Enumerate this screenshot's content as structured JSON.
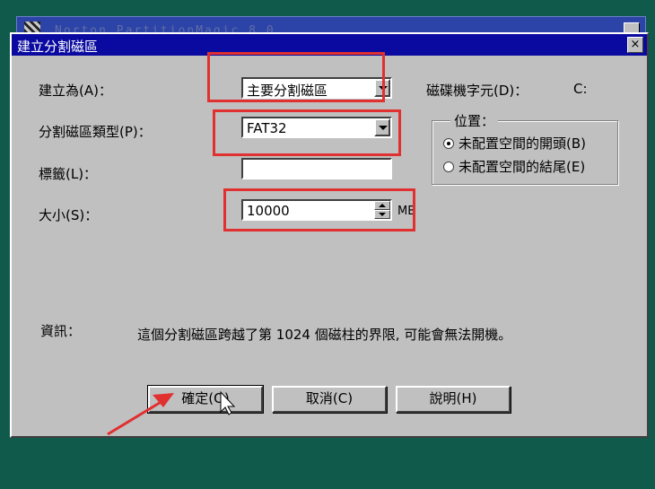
{
  "background_window": {
    "title": "Norton PartitionMagic 8.0"
  },
  "dialog": {
    "title": "建立分割磁區",
    "close_label": "×",
    "create_as": {
      "label": "建立為(A)：",
      "value": "主要分割磁區"
    },
    "partition_type": {
      "label": "分割磁區類型(P)：",
      "value": "FAT32"
    },
    "volume_label": {
      "label": "標籤(L)：",
      "value": ""
    },
    "size": {
      "label": "大小(S)：",
      "value": "10000",
      "unit": "MB"
    },
    "drive_letter": {
      "label": "磁碟機字元(D)：",
      "value": "C:"
    },
    "position": {
      "title": "位置：",
      "options": [
        {
          "label": "未配置空間的開頭(B)",
          "selected": true
        },
        {
          "label": "未配置空間的結尾(E)",
          "selected": false
        }
      ]
    },
    "info": {
      "label": "資訊：",
      "text": "這個分割磁區跨越了第 1024 個磁柱的界限, 可能會無法開機。"
    },
    "buttons": {
      "ok": "確定(O)",
      "cancel": "取消(C)",
      "help": "說明(H)"
    }
  },
  "annotation_color": "#e03030"
}
